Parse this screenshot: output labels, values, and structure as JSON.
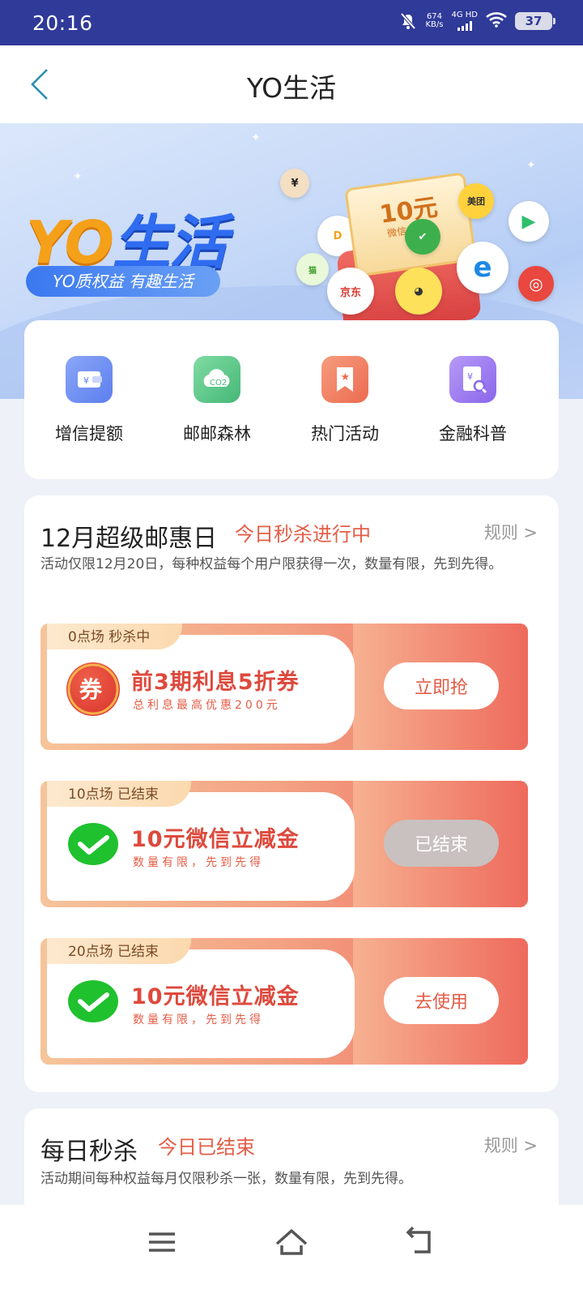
{
  "status_bar": {
    "time": "20:16",
    "net_speed_value": "674",
    "net_speed_unit": "KB/s",
    "network": "4G HD",
    "battery": "37"
  },
  "nav": {
    "title": "YO生活"
  },
  "banner": {
    "logo_yo": "YO",
    "logo_life": "生活",
    "slogan": "YO质权益 有趣生活",
    "coupon_amount": "10元",
    "coupon_sub": "微信立减金",
    "brands": [
      "美团",
      "京东"
    ]
  },
  "quick_menu": [
    {
      "label": "增信提额",
      "icon": "wallet-icon",
      "color": "#6f8ff2"
    },
    {
      "label": "邮邮森林",
      "icon": "co2-cloud-icon",
      "color": "#5cc98a"
    },
    {
      "label": "热门活动",
      "icon": "bookmark-star-icon",
      "color": "#f07b5e"
    },
    {
      "label": "金融科普",
      "icon": "document-search-icon",
      "color": "#9b7bf0"
    }
  ],
  "promo": {
    "title": "12月超级邮惠日",
    "status": "今日秒杀进行中",
    "rules": "规则 >",
    "description": "活动仅限12月20日，每种权益每个用户限获得一次，数量有限，先到先得。",
    "offers": [
      {
        "tag": "0点场 秒杀中",
        "title": "前3期利息5折券",
        "subtitle": "总利息最高优惠200元",
        "button": "立即抢",
        "icon": "coupon-icon",
        "disabled": false
      },
      {
        "tag": "10点场 已结束",
        "title": "10元微信立减金",
        "subtitle": "数量有限，先到先得",
        "button": "已结束",
        "icon": "wechat-icon",
        "disabled": true
      },
      {
        "tag": "20点场 已结束",
        "title": "10元微信立减金",
        "subtitle": "数量有限，先到先得",
        "button": "去使用",
        "icon": "wechat-icon",
        "disabled": false
      }
    ]
  },
  "daily": {
    "title": "每日秒杀",
    "status": "今日已结束",
    "rules": "规则 >",
    "description": "活动期间每种权益每月仅限秒杀一张，数量有限，先到先得。"
  },
  "colors": {
    "status_bar": "#2f3a99",
    "accent_red": "#e35d47",
    "brand_blue": "#2f6cf0",
    "brand_orange": "#f5a019"
  }
}
